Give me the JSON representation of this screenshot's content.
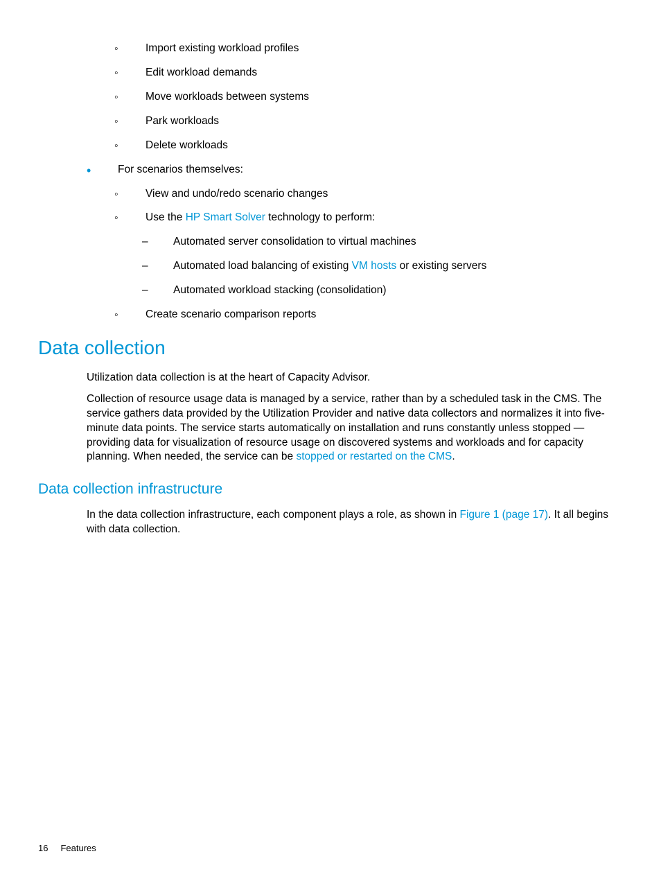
{
  "lists": {
    "workloads": {
      "items": [
        "Import existing workload profiles",
        "Edit workload demands",
        "Move workloads between systems",
        "Park workloads",
        "Delete workloads"
      ]
    },
    "scenarios_header": "For scenarios themselves:",
    "scenarios": {
      "item0": "View and undo/redo scenario changes",
      "item1_prefix": "Use the ",
      "item1_link": "HP Smart Solver",
      "item1_suffix": " technology to perform:",
      "automated": [
        "Automated server consolidation to virtual machines",
        "Automated workload stacking (consolidation)"
      ],
      "automated_mid_prefix": "Automated load balancing of existing ",
      "automated_mid_link": "VM hosts",
      "automated_mid_suffix": " or existing servers",
      "item2": "Create scenario comparison reports"
    }
  },
  "section": {
    "title": "Data collection",
    "para1": "Utilization data collection is at the heart of Capacity Advisor.",
    "para2_prefix": "Collection of resource usage data is managed by a service, rather than by a scheduled task in the CMS. The service gathers data provided by the Utilization Provider and native data collectors and normalizes it into five-minute data points. The service starts automatically on installation and runs constantly unless stopped — providing data for visualization of resource usage on discovered systems and workloads and for capacity planning. When needed, the service can be ",
    "para2_link": "stopped or restarted on the CMS",
    "para2_suffix": "."
  },
  "subsection": {
    "title": "Data collection infrastructure",
    "para_prefix": "In the data collection infrastructure, each component plays a role, as shown in ",
    "para_link": "Figure 1 (page 17)",
    "para_suffix": ". It all begins with data collection."
  },
  "footer": {
    "page": "16",
    "label": "Features"
  }
}
